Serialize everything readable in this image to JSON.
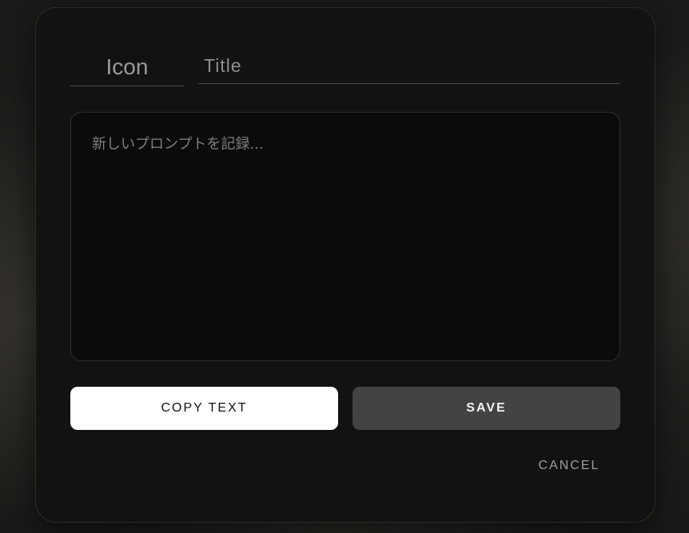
{
  "form": {
    "icon_placeholder": "Icon",
    "title_placeholder": "Title",
    "prompt_placeholder": "新しいプロンプトを記録..."
  },
  "actions": {
    "copy_label": "COPY TEXT",
    "save_label": "SAVE",
    "cancel_label": "CANCEL"
  }
}
